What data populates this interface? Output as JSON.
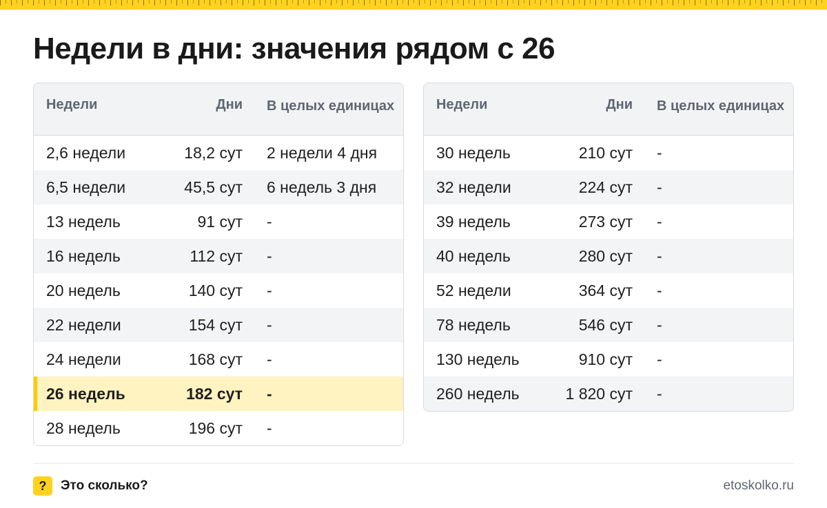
{
  "title": "Недели в дни: значения рядом с 26",
  "columns": {
    "weeks": "Недели",
    "days": "Дни",
    "whole_units": "В целых единицах"
  },
  "left_table": {
    "rows": [
      {
        "weeks": "2,6 недели",
        "days": "18,2 сут",
        "whole": "2 недели 4 дня"
      },
      {
        "weeks": "6,5 недели",
        "days": "45,5 сут",
        "whole": "6 недель 3 дня"
      },
      {
        "weeks": "13 недель",
        "days": "91 сут",
        "whole": "-"
      },
      {
        "weeks": "16 недель",
        "days": "112 сут",
        "whole": "-"
      },
      {
        "weeks": "20 недель",
        "days": "140 сут",
        "whole": "-"
      },
      {
        "weeks": "22 недели",
        "days": "154 сут",
        "whole": "-"
      },
      {
        "weeks": "24 недели",
        "days": "168 сут",
        "whole": "-"
      },
      {
        "weeks": "26 недель",
        "days": "182 сут",
        "whole": "-",
        "highlight": true
      },
      {
        "weeks": "28 недель",
        "days": "196 сут",
        "whole": "-"
      }
    ]
  },
  "right_table": {
    "rows": [
      {
        "weeks": "30 недель",
        "days": "210 сут",
        "whole": "-"
      },
      {
        "weeks": "32 недели",
        "days": "224 сут",
        "whole": "-"
      },
      {
        "weeks": "39 недель",
        "days": "273 сут",
        "whole": "-"
      },
      {
        "weeks": "40 недель",
        "days": "280 сут",
        "whole": "-"
      },
      {
        "weeks": "52 недели",
        "days": "364 сут",
        "whole": "-"
      },
      {
        "weeks": "78 недель",
        "days": "546 сут",
        "whole": "-"
      },
      {
        "weeks": "130 недель",
        "days": "910 сут",
        "whole": "-"
      },
      {
        "weeks": "260 недель",
        "days": "1 820 сут",
        "whole": "-"
      }
    ]
  },
  "footer": {
    "badge": "?",
    "name": "Это сколько?",
    "site": "etoskolko.ru"
  },
  "colors": {
    "accent": "#ffd21f",
    "highlight_row": "#fff3c2",
    "header_bg": "#f2f3f5"
  }
}
